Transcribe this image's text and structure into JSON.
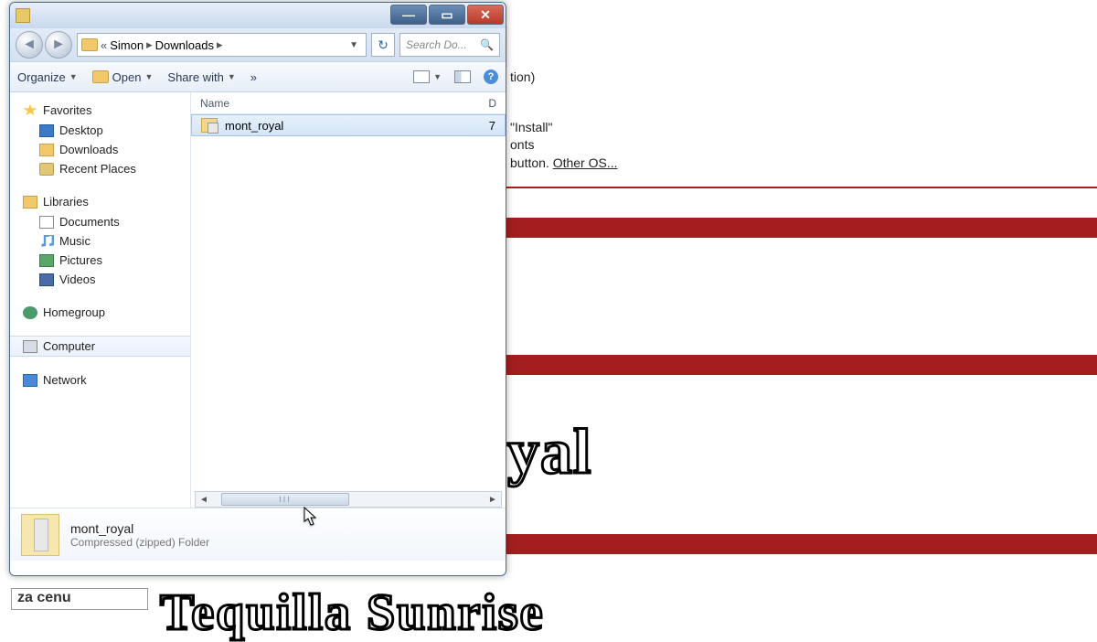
{
  "bg": {
    "text_tion": "tion)",
    "text_install": "\"Install\"",
    "text_onts": "onts",
    "text_button": " button. ",
    "link_other_os": "Other OS...",
    "fancy1": "yal",
    "fancy2": "Tequilla Sunrise",
    "ad": "za cenu"
  },
  "window": {
    "title": "",
    "buttons": {
      "min": "—",
      "max": "▭",
      "close": "✕"
    },
    "breadcrumb": {
      "prefix": "«",
      "p1": "Simon",
      "p2": "Downloads"
    },
    "refresh": "↻",
    "search_placeholder": "Search Do...",
    "toolbar": {
      "organize": "Organize",
      "open": "Open",
      "share": "Share with",
      "overflow": "»",
      "help": "?"
    },
    "nav": {
      "favorites": "Favorites",
      "desktop": "Desktop",
      "downloads": "Downloads",
      "recent": "Recent Places",
      "libraries": "Libraries",
      "documents": "Documents",
      "music": "Music",
      "pictures": "Pictures",
      "videos": "Videos",
      "homegroup": "Homegroup",
      "computer": "Computer",
      "network": "Network"
    },
    "list": {
      "col_name": "Name",
      "col_d": "D",
      "rows": [
        {
          "name": "mont_royal",
          "d": "7"
        }
      ],
      "scroll_thumb": "III"
    },
    "details": {
      "name": "mont_royal",
      "type": "Compressed (zipped) Folder"
    }
  }
}
